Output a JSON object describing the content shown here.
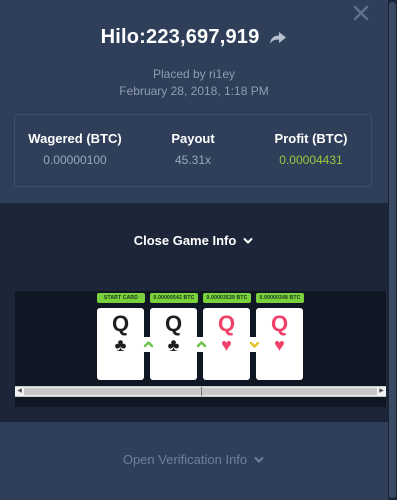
{
  "header": {
    "title": "Hilo:223,697,919",
    "placed_by": "Placed by ri1ey",
    "date": "February 28, 2018, 1:18 PM"
  },
  "stats": {
    "wagered_label": "Wagered (BTC)",
    "wagered_value": "0.00000100",
    "payout_label": "Payout",
    "payout_value": "45.31x",
    "profit_label": "Profit (BTC)",
    "profit_value": "0.00004431"
  },
  "game": {
    "toggle_label": "Close Game Info",
    "cards": [
      {
        "badge": "START CARD",
        "rank": "Q",
        "suit": "♣",
        "color": "black"
      },
      {
        "badge": "0.00000542 BTC",
        "rank": "Q",
        "suit": "♣",
        "color": "black"
      },
      {
        "badge": "0.00003539 BTC",
        "rank": "Q",
        "suit": "♥",
        "color": "red"
      },
      {
        "badge": "0.00000348 BTC",
        "rank": "Q",
        "suit": "♥",
        "color": "red"
      }
    ],
    "moves": [
      "higher",
      "higher",
      "lower"
    ]
  },
  "verification": {
    "label": "Open Verification Info"
  },
  "icons": {
    "close": "close-icon",
    "share": "share-icon",
    "chevron": "chevron-down-icon",
    "higher": "chevron-up-icon",
    "lower": "chevron-down-icon"
  },
  "colors": {
    "background": "#2f3f5a",
    "panel": "#1c2638",
    "profit": "#98c93c",
    "badge": "#7ad13b",
    "suit_red": "#f0416a"
  }
}
